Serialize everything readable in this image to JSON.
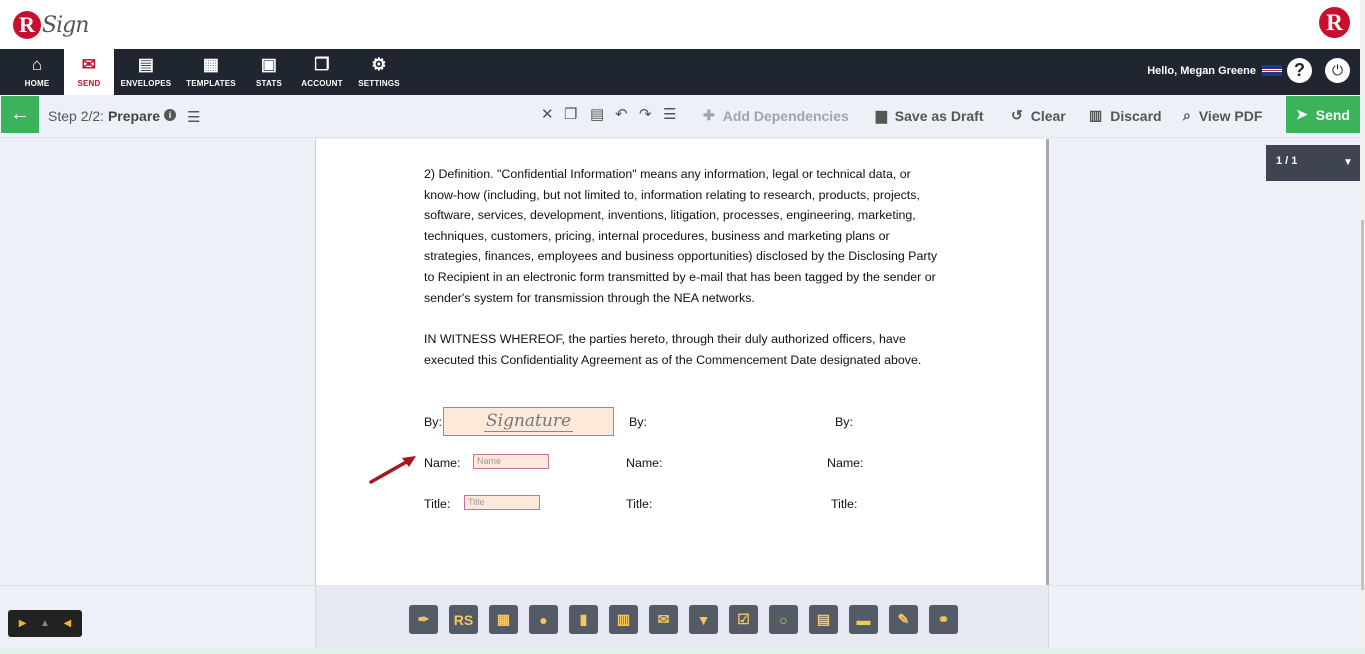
{
  "header": {
    "logo_text": "RSign",
    "logo_letter": "R"
  },
  "nav": {
    "items": [
      {
        "label": "HOME",
        "icon": "home-icon"
      },
      {
        "label": "SEND",
        "icon": "envelope-icon"
      },
      {
        "label": "ENVELOPES",
        "icon": "inbox-icon"
      },
      {
        "label": "TEMPLATES",
        "icon": "document-icon"
      },
      {
        "label": "STATS",
        "icon": "briefcase-icon"
      },
      {
        "label": "ACCOUNT",
        "icon": "files-icon"
      },
      {
        "label": "SETTINGS",
        "icon": "gear-icon"
      }
    ],
    "active": "SEND",
    "greeting": "Hello, Megan Greene"
  },
  "toolbar": {
    "step_prefix": "Step 2/2:",
    "step_name": "Prepare",
    "add_dependencies": "Add Dependencies",
    "save_draft": "Save as Draft",
    "clear": "Clear",
    "discard": "Discard",
    "view_pdf": "View PDF",
    "send": "Send"
  },
  "document": {
    "paragraph1": "2) Definition.  \"Confidential Information\" means any information, legal or technical data, or know-how (including, but not limited to, information relating to research, products, projects, software, services, development, inventions, litigation, processes, engineering, marketing, techniques, customers, pricing, internal procedures, business and marketing plans or strategies, finances, employees and business opportunities) disclosed by the Disclosing Party to Recipient in an electronic form transmitted by e-mail that has been tagged by the sender or sender's system for transmission through the NEA networks.",
    "paragraph2": "IN WITNESS WHEREOF, the parties hereto, through their duly authorized officers, have executed this Confidentiality Agreement as of the Commencement Date designated above.",
    "by_label": "By:",
    "name_label": "Name:",
    "title_label": "Title:",
    "signature_field": "Signature",
    "name_field": "Name",
    "title_field": "Title"
  },
  "pager": {
    "page": "1 / 1"
  },
  "colors": {
    "brand_red": "#c8102e",
    "send_green": "#3bb35a",
    "nav_dark": "#1f2630",
    "field_fill": "#fde9d9",
    "field_border": "#d26ba0"
  },
  "tools": [
    {
      "icon": "pen-icon",
      "glyph": "✒"
    },
    {
      "icon": "initials-icon",
      "glyph": "RS"
    },
    {
      "icon": "date-stamp-icon",
      "glyph": "▦"
    },
    {
      "icon": "person-icon",
      "glyph": "●"
    },
    {
      "icon": "clipboard-icon",
      "glyph": "▮"
    },
    {
      "icon": "building-icon",
      "glyph": "▥"
    },
    {
      "icon": "email-icon",
      "glyph": "✉"
    },
    {
      "icon": "dropdown-icon",
      "glyph": "▼"
    },
    {
      "icon": "checkbox-icon",
      "glyph": "☑"
    },
    {
      "icon": "radio-icon",
      "glyph": "○"
    },
    {
      "icon": "calendar-icon",
      "glyph": "▤"
    },
    {
      "icon": "text-field-icon",
      "glyph": "▬"
    },
    {
      "icon": "label-tag-icon",
      "glyph": "✎"
    },
    {
      "icon": "hyperlink-icon",
      "glyph": "⚭"
    }
  ]
}
